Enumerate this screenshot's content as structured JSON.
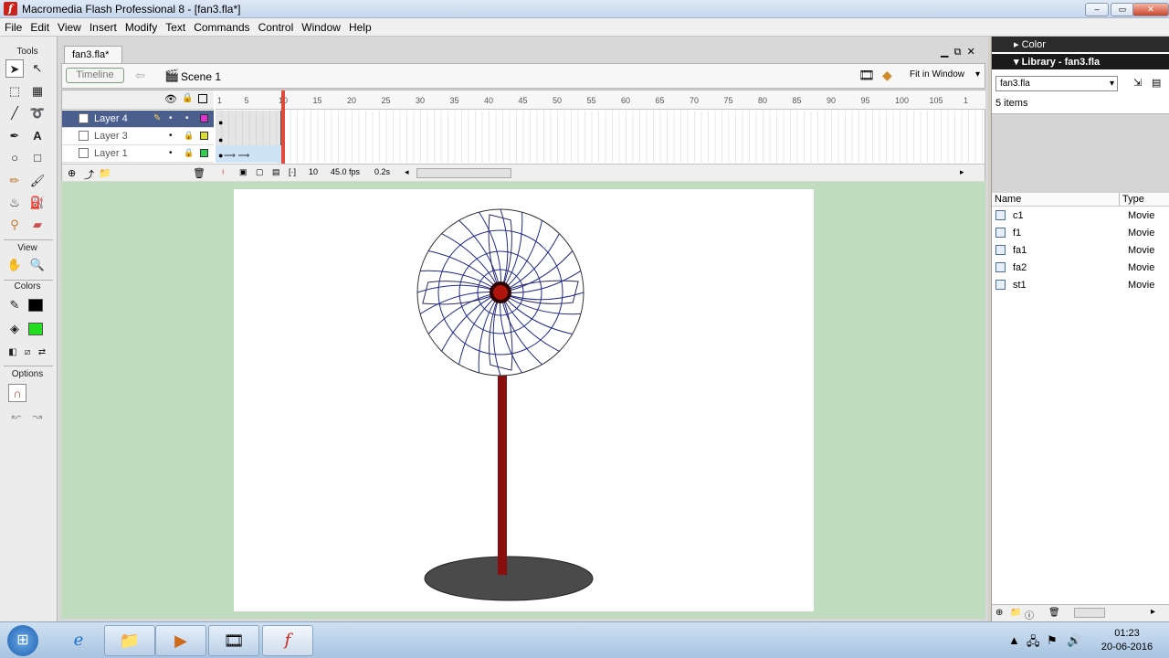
{
  "window": {
    "title": "Macromedia Flash Professional 8 - [fan3.fla*]",
    "min": "–",
    "max": "▭",
    "close": "✕"
  },
  "menu": [
    "File",
    "Edit",
    "View",
    "Insert",
    "Modify",
    "Text",
    "Commands",
    "Control",
    "Window",
    "Help"
  ],
  "tools": {
    "title": "Tools",
    "view_label": "View",
    "colors_label": "Colors",
    "options_label": "Options",
    "stroke_color": "#000000",
    "fill_color": "#22dd22"
  },
  "document": {
    "tab": "fan3.fla*",
    "timeline_button": "Timeline",
    "scene": "Scene 1",
    "zoom": "Fit in Window"
  },
  "timeline": {
    "layers": [
      {
        "name": "Layer 4",
        "active": true,
        "color": "#dd33cc"
      },
      {
        "name": "Layer 3",
        "active": false,
        "color": "#dddd33"
      },
      {
        "name": "Layer 1",
        "active": false,
        "color": "#33cc55"
      }
    ],
    "ruler": [
      "1",
      "5",
      "10",
      "15",
      "20",
      "25",
      "30",
      "35",
      "40",
      "45",
      "50",
      "55",
      "60",
      "65",
      "70",
      "75",
      "80",
      "85",
      "90",
      "95",
      "100",
      "105",
      "1"
    ],
    "current_frame": "10",
    "fps": "45.0 fps",
    "elapsed": "0.2s"
  },
  "right_panels": {
    "color_header": "Color",
    "library_header": "Library - fan3.fla",
    "library_select": "fan3.fla",
    "item_count": "5 items",
    "col_name": "Name",
    "col_type": "Type",
    "items": [
      {
        "name": "c1",
        "type": "Movie"
      },
      {
        "name": "f1",
        "type": "Movie"
      },
      {
        "name": "fa1",
        "type": "Movie"
      },
      {
        "name": "fa2",
        "type": "Movie"
      },
      {
        "name": "st1",
        "type": "Movie"
      }
    ]
  },
  "stage_art": {
    "guard_color": "#1f2a8c",
    "hub_color": "#b0140e",
    "pole_color": "#8a0d0d",
    "base_color": "#4a4a4a"
  },
  "taskbar": {
    "time": "01:23",
    "date": "20-06-2016"
  }
}
